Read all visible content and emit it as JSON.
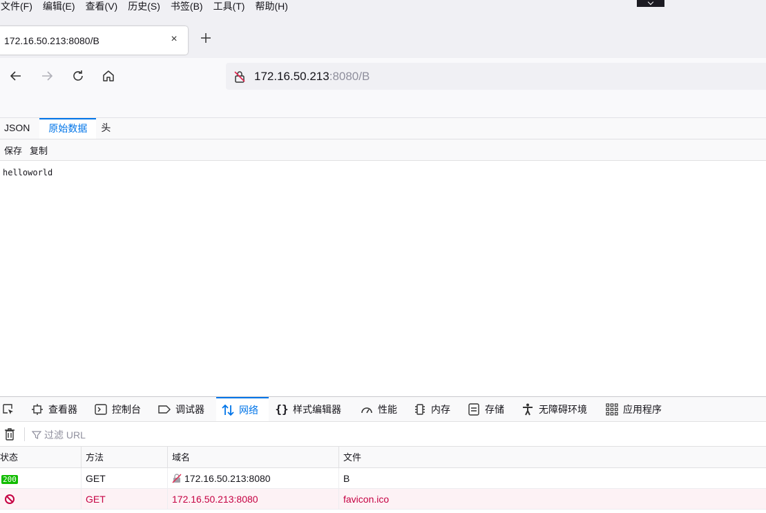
{
  "menu": [
    "文件(F)",
    "编辑(E)",
    "查看(V)",
    "历史(S)",
    "书签(B)",
    "工具(T)",
    "帮助(H)"
  ],
  "tab": {
    "title": "172.16.50.213:8080/B",
    "close_icon": "close-icon",
    "new_tab_icon": "plus-icon"
  },
  "nav": {
    "url_host": "172.16.50.213",
    "url_rest": ":8080/B"
  },
  "viewer": {
    "tabs": [
      "JSON",
      "原始数据",
      "头"
    ],
    "selected_tab": "原始数据",
    "save_label": "保存",
    "copy_label": "复制",
    "raw_text": "helloworld"
  },
  "devtools": {
    "tabs": [
      "查看器",
      "控制台",
      "调试器",
      "网络",
      "样式编辑器",
      "性能",
      "内存",
      "存储",
      "无障碍环境",
      "应用程序"
    ],
    "selected_tab": "网络",
    "filter_placeholder": "过滤 URL",
    "columns": [
      "状态",
      "方法",
      "域名",
      "文件"
    ],
    "rows": [
      {
        "status": "200",
        "method": "GET",
        "domain": "172.16.50.213:8080",
        "file": "B",
        "error": false
      },
      {
        "status": "",
        "method": "GET",
        "domain": "172.16.50.213:8080",
        "file": "favicon.ico",
        "error": true
      }
    ]
  },
  "colors": {
    "accent": "#0074e8",
    "status_ok": "#12bc00",
    "error": "#c50042"
  }
}
